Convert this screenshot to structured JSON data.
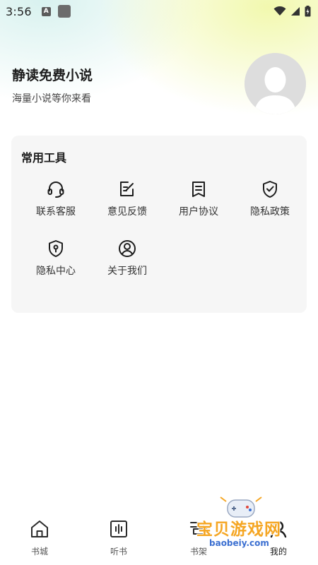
{
  "status_bar": {
    "time": "3:56",
    "notification_letter": "A"
  },
  "header": {
    "title": "静读免费小说",
    "subtitle": "海量小说等你来看"
  },
  "tools": {
    "title": "常用工具",
    "items": [
      {
        "label": "联系客服",
        "icon": "headset-icon"
      },
      {
        "label": "意见反馈",
        "icon": "edit-note-icon"
      },
      {
        "label": "用户协议",
        "icon": "document-icon"
      },
      {
        "label": "隐私政策",
        "icon": "shield-check-icon"
      },
      {
        "label": "隐私中心",
        "icon": "shield-lock-icon"
      },
      {
        "label": "关于我们",
        "icon": "user-circle-icon"
      }
    ]
  },
  "bottom_nav": {
    "items": [
      {
        "label": "书城",
        "icon": "home-icon"
      },
      {
        "label": "听书",
        "icon": "audio-icon"
      },
      {
        "label": "书架",
        "icon": "bookshelf-icon"
      },
      {
        "label": "我的",
        "icon": "profile-icon",
        "active": true
      }
    ]
  },
  "watermark": {
    "text": "宝贝游戏网",
    "url": "baobeiy.com"
  },
  "colors": {
    "accent_yellow": "#f1f8aa",
    "accent_mint": "#d6f1ee",
    "card_bg": "#f6f6f6",
    "watermark_orange": "#f5a623"
  }
}
